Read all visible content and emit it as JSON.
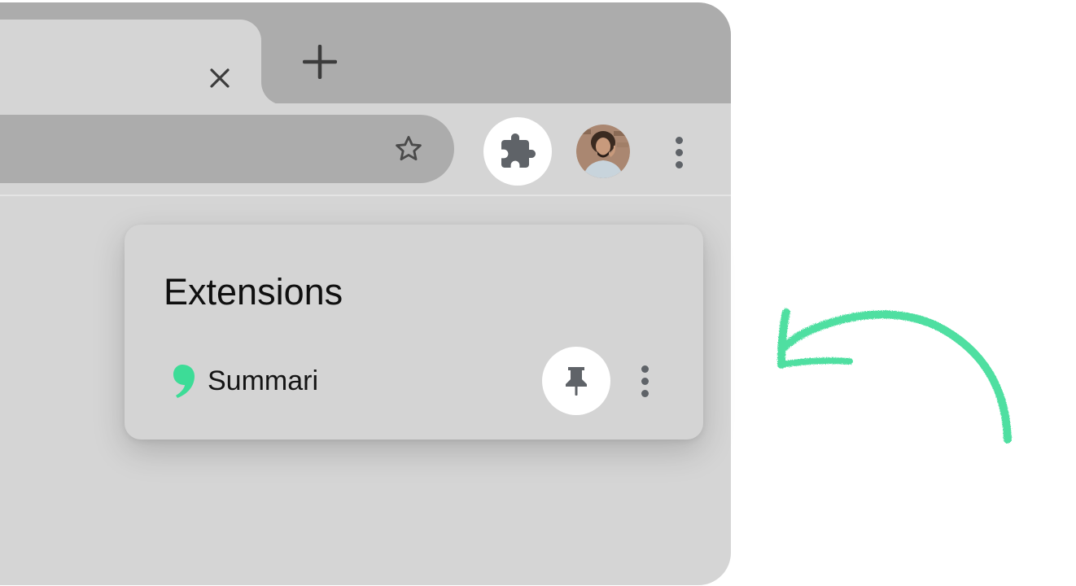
{
  "browser": {
    "tab": {
      "close_icon": "close-icon",
      "new_tab_icon": "plus-icon"
    },
    "toolbar": {
      "bookmark_icon": "star-outline-icon",
      "extensions_icon": "puzzle-piece-icon",
      "profile": "avatar",
      "menu_icon": "more-vert-icon"
    }
  },
  "extensions_popup": {
    "title": "Extensions",
    "items": [
      {
        "name": "Summari",
        "logo_color": "#3ddc97",
        "pin_icon": "pin-icon",
        "menu_icon": "more-vert-icon"
      }
    ]
  },
  "colors": {
    "chrome_dark": "#acacac",
    "chrome_light": "#d5d5d5",
    "icon_gray": "#5f6368",
    "accent_green": "#3ddc97",
    "annotation_arrow": "#3ddc97"
  }
}
